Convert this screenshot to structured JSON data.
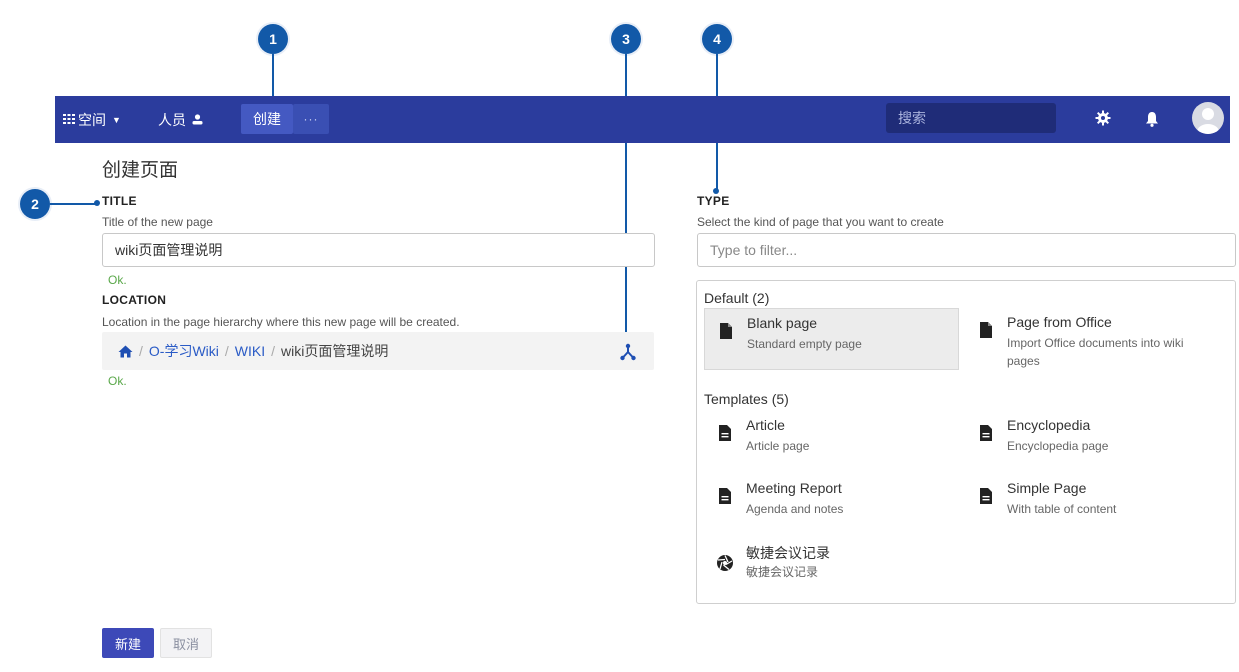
{
  "callouts": [
    "1",
    "2",
    "3",
    "4"
  ],
  "nav": {
    "spaces_label": "空间",
    "people_label": "人员",
    "create_label": "创建",
    "more_label": "···",
    "search_placeholder": "搜索"
  },
  "page": {
    "heading": "创建页面"
  },
  "title_section": {
    "label": "TITLE",
    "description": "Title of the new page",
    "value": "wiki页面管理说明",
    "status": "Ok."
  },
  "location_section": {
    "label": "LOCATION",
    "description": "Location in the page hierarchy where this new page will be created.",
    "breadcrumb": [
      "O-学习Wiki",
      "WIKI",
      "wiki页面管理说明"
    ],
    "separator": "/",
    "status": "Ok."
  },
  "type_section": {
    "label": "TYPE",
    "description": "Select the kind of page that you want to create",
    "filter_placeholder": "Type to filter...",
    "default_group": "Default (2)",
    "templates_group": "Templates (5)",
    "default_items": [
      {
        "name": "Blank page",
        "desc": "Standard empty page",
        "icon": "file-icon"
      },
      {
        "name": "Page from Office",
        "desc": "Import Office documents into wiki pages",
        "icon": "file-icon"
      }
    ],
    "template_items": [
      {
        "name": "Article",
        "desc": "Article page",
        "icon": "document-icon"
      },
      {
        "name": "Encyclopedia",
        "desc": "Encyclopedia page",
        "icon": "document-icon"
      },
      {
        "name": "Meeting Report",
        "desc": "Agenda and notes",
        "icon": "document-icon"
      },
      {
        "name": "Simple Page",
        "desc": "With table of content",
        "icon": "document-icon"
      },
      {
        "name": "敏捷会议记录",
        "desc": "敏捷会议记录",
        "icon": "aperture-icon"
      }
    ]
  },
  "actions": {
    "create_label": "新建",
    "cancel_label": "取消"
  },
  "colors": {
    "navbar": "#2b3c9d",
    "callout": "#1259a8",
    "ok": "#5aa84a",
    "link": "#2a5bc6"
  }
}
